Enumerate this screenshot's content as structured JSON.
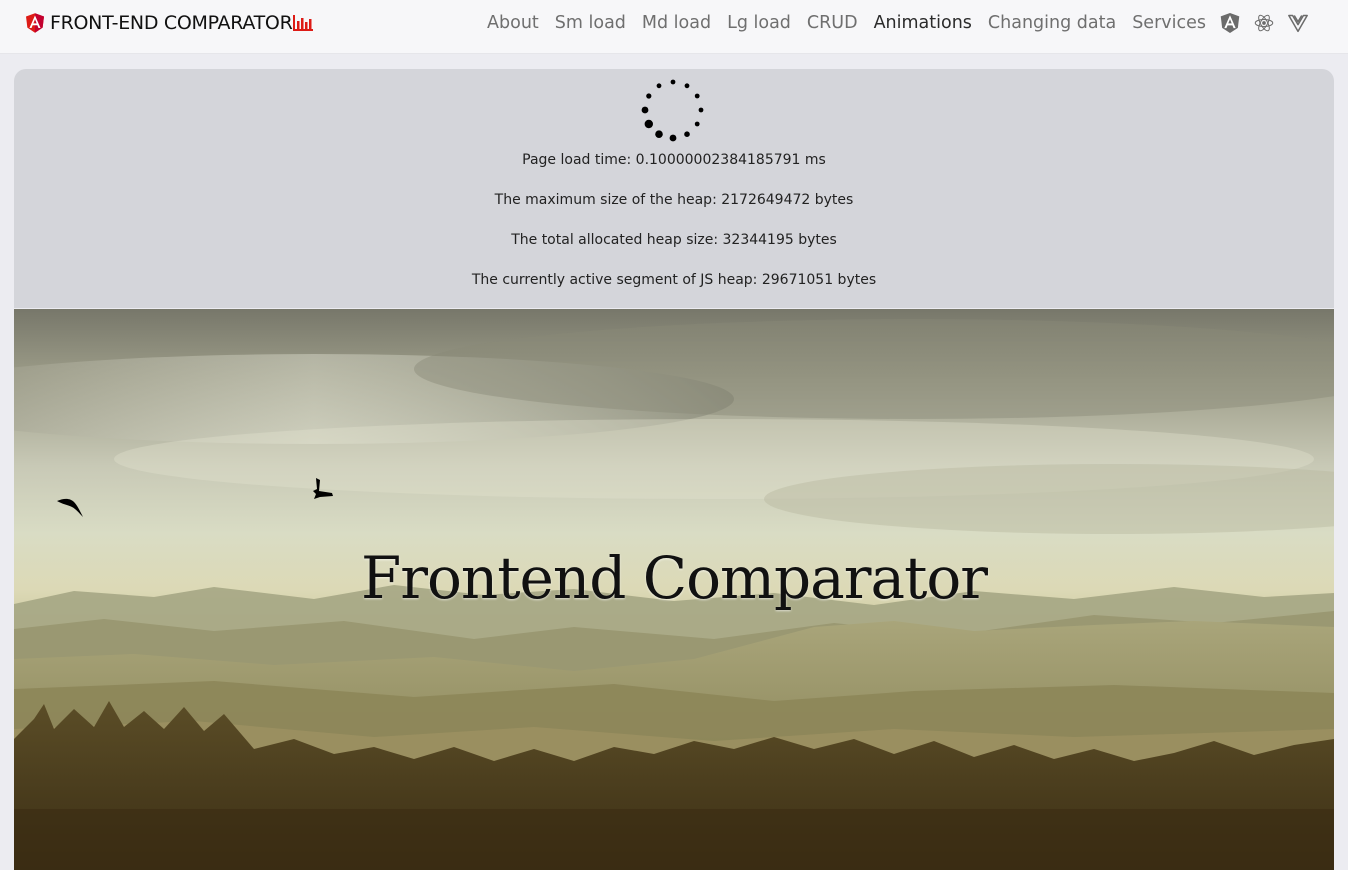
{
  "header": {
    "brand": "FRONT-END COMPARATOR",
    "brand_icon": "angular-logo-icon",
    "brand_suffix_icon": "bar-chart-icon",
    "brand_color": "#dd1b16",
    "nav": [
      {
        "label": "About",
        "active": false
      },
      {
        "label": "Sm load",
        "active": false
      },
      {
        "label": "Md load",
        "active": false
      },
      {
        "label": "Lg load",
        "active": false
      },
      {
        "label": "CRUD",
        "active": false
      },
      {
        "label": "Animations",
        "active": true
      },
      {
        "label": "Changing data",
        "active": false
      },
      {
        "label": "Services",
        "active": false
      }
    ],
    "framework_icons": [
      "angular-icon",
      "react-icon",
      "vue-icon"
    ]
  },
  "stats": {
    "page_load": "Page load time: 0.10000002384185791 ms",
    "heap_max": "The maximum size of the heap: 2172649472 bytes",
    "heap_total": "The total allocated heap size: 32344195 bytes",
    "heap_active": "The currently active segment of JS heap: 29671051 bytes"
  },
  "hero": {
    "title": "Frontend Comparator",
    "birds": [
      "bird-icon",
      "bird-icon"
    ]
  }
}
